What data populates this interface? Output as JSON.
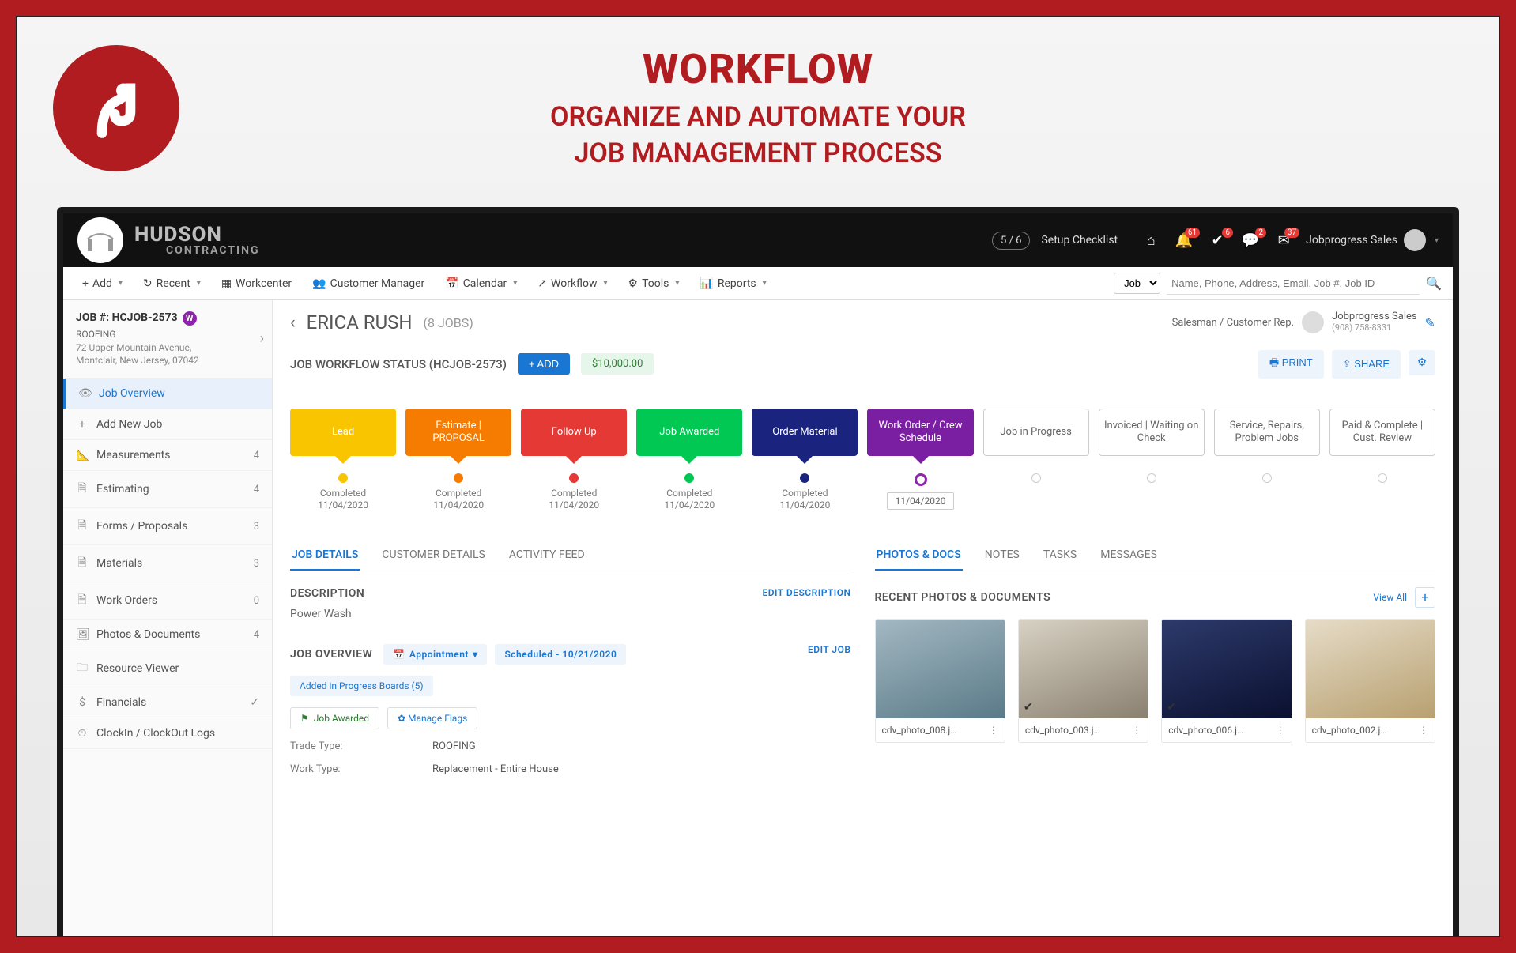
{
  "hero": {
    "title": "WORKFLOW",
    "subtitle_l1": "ORGANIZE AND AUTOMATE YOUR",
    "subtitle_l2": "JOB MANAGEMENT PROCESS"
  },
  "company": {
    "line1": "HUDSON",
    "line2": "CONTRACTING"
  },
  "topbar": {
    "setup_count": "5 / 6",
    "setup_label": "Setup Checklist",
    "badges": {
      "bell": "61",
      "check": "6",
      "chat": "2",
      "mail": "37"
    },
    "user": "Jobprogress Sales"
  },
  "menu": {
    "add": "Add",
    "recent": "Recent",
    "workcenter": "Workcenter",
    "customer_manager": "Customer Manager",
    "calendar": "Calendar",
    "workflow": "Workflow",
    "tools": "Tools",
    "reports": "Reports",
    "search_select": "Job",
    "search_placeholder": "Name, Phone, Address, Email, Job #, Job ID"
  },
  "job_header": {
    "number": "JOB #: HCJOB-2573",
    "pill": "W",
    "trade": "ROOFING",
    "addr_l1": "72 Upper Mountain Avenue,",
    "addr_l2": "Montclair, New Jersey, 07042"
  },
  "sidebar": [
    {
      "icon": "👁",
      "label": "Job Overview",
      "active": true
    },
    {
      "icon": "+",
      "label": "Add New Job"
    },
    {
      "icon": "📐",
      "label": "Measurements",
      "count": "4"
    },
    {
      "icon": "🗎",
      "label": "Estimating",
      "count": "4"
    },
    {
      "icon": "🗎",
      "label": "Forms / Proposals",
      "count": "3"
    },
    {
      "icon": "🗎",
      "label": "Materials",
      "count": "3"
    },
    {
      "icon": "🗎",
      "label": "Work Orders",
      "count": "0"
    },
    {
      "icon": "🖼",
      "label": "Photos & Documents",
      "count": "4"
    },
    {
      "icon": "🗀",
      "label": "Resource Viewer"
    },
    {
      "icon": "$",
      "label": "Financials",
      "check": true
    },
    {
      "icon": "⏱",
      "label": "ClockIn / ClockOut Logs"
    }
  ],
  "main_head": {
    "customer": "ERICA RUSH",
    "jobs": "(8 JOBS)",
    "rep_label": "Salesman / Customer Rep.",
    "rep_name": "Jobprogress Sales",
    "rep_phone": "(908) 758-8331"
  },
  "status": {
    "label": "JOB WORKFLOW STATUS (HCJOB-2573)",
    "add": "+  ADD",
    "amount": "$10,000.00",
    "print": "🖶  PRINT",
    "share": "⇪  SHARE"
  },
  "stages": [
    {
      "label": "Lead",
      "color": "#f9c400",
      "dot": "#f9c400",
      "meta1": "Completed",
      "meta2": "11/04/2020"
    },
    {
      "label": "Estimate | PROPOSAL",
      "color": "#f57c00",
      "dot": "#f57c00",
      "meta1": "Completed",
      "meta2": "11/04/2020"
    },
    {
      "label": "Follow Up",
      "color": "#e53935",
      "dot": "#e53935",
      "meta1": "Completed",
      "meta2": "11/04/2020"
    },
    {
      "label": "Job Awarded",
      "color": "#00c853",
      "dot": "#00c853",
      "meta1": "Completed",
      "meta2": "11/04/2020"
    },
    {
      "label": "Order Material",
      "color": "#1a237e",
      "dot": "#1a237e",
      "meta1": "Completed",
      "meta2": "11/04/2020"
    },
    {
      "label": "Work Order / Crew Schedule",
      "color": "#7b1fa2",
      "dot": "ring",
      "current": true,
      "datebox": "11/04/2020"
    },
    {
      "label": "Job in Progress",
      "outline": true
    },
    {
      "label": "Invoiced | Waiting on Check",
      "outline": true
    },
    {
      "label": "Service, Repairs, Problem Jobs",
      "outline": true
    },
    {
      "label": "Paid & Complete | Cust. Review",
      "outline": true
    }
  ],
  "left_tabs": [
    "JOB DETAILS",
    "CUSTOMER DETAILS",
    "ACTIVITY FEED"
  ],
  "right_tabs": [
    "PHOTOS & DOCS",
    "NOTES",
    "TASKS",
    "MESSAGES"
  ],
  "description": {
    "title": "DESCRIPTION",
    "edit": "EDIT DESCRIPTION",
    "text": "Power Wash"
  },
  "overview": {
    "title": "JOB OVERVIEW",
    "appointment": "Appointment",
    "scheduled": "Scheduled - 10/21/2020",
    "edit": "EDIT JOB",
    "boards": "Added in Progress Boards (5)",
    "awarded": "Job Awarded",
    "manage_flags": "Manage Flags",
    "trade_k": "Trade Type:",
    "trade_v": "ROOFING",
    "work_k": "Work Type:",
    "work_v": "Replacement - Entire House"
  },
  "docs": {
    "title": "RECENT PHOTOS & DOCUMENTS",
    "view_all": "View All",
    "items": [
      {
        "name": "cdv_photo_008.j…",
        "check": false,
        "bg": "linear-gradient(160deg,#a3b8c2,#5a7a88)"
      },
      {
        "name": "cdv_photo_003.j…",
        "check": true,
        "bg": "linear-gradient(160deg,#d8d2c4,#8a8070)"
      },
      {
        "name": "cdv_photo_006.j…",
        "check": true,
        "bg": "linear-gradient(160deg,#2d3a6b,#0a1030)"
      },
      {
        "name": "cdv_photo_002.j…",
        "check": false,
        "bg": "linear-gradient(160deg,#e6dcc8,#b8a070)"
      }
    ]
  }
}
